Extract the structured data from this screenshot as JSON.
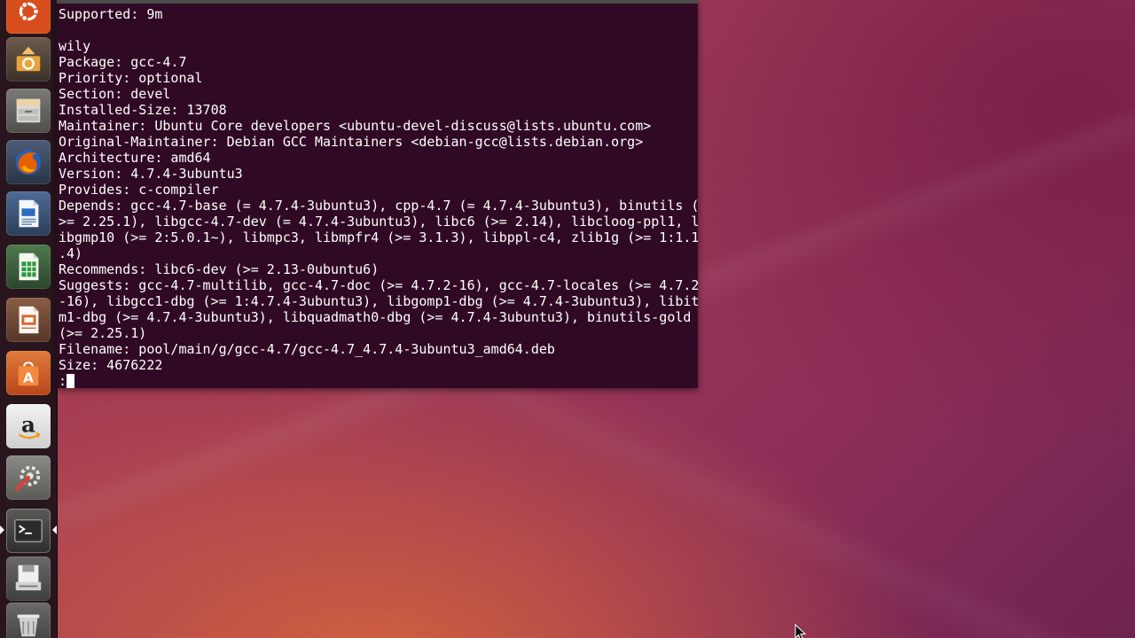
{
  "launcher": {
    "items": [
      {
        "name": "dash-home",
        "icon": "ubuntu-logo-icon",
        "color": "#dd4814"
      },
      {
        "name": "system-updater",
        "icon": "software-updater-icon",
        "color": "#e8a33c"
      },
      {
        "name": "files",
        "icon": "file-cabinet-icon",
        "color": "#8a8a86"
      },
      {
        "name": "firefox",
        "icon": "firefox-icon",
        "color": "#e66000"
      },
      {
        "name": "libreoffice-writer",
        "icon": "writer-document-icon",
        "color": "#2a6cc4"
      },
      {
        "name": "libreoffice-calc",
        "icon": "calc-spreadsheet-icon",
        "color": "#2e9a3e"
      },
      {
        "name": "libreoffice-impress",
        "icon": "impress-presentation-icon",
        "color": "#d9642b"
      },
      {
        "name": "ubuntu-software-center",
        "icon": "shopping-bag-icon",
        "color": "#e86a23"
      },
      {
        "name": "amazon",
        "icon": "amazon-icon",
        "color": "#f4f4f4"
      },
      {
        "name": "system-settings",
        "icon": "wrench-gear-icon",
        "color": "#c9c9c9"
      },
      {
        "name": "terminal",
        "icon": "terminal-icon",
        "color": "#2d2d2d",
        "active": true
      },
      {
        "name": "disk-drive",
        "icon": "floppy-drive-icon",
        "color": "#dcdcdc"
      },
      {
        "name": "trash",
        "icon": "trash-icon",
        "color": "#b9b9b9"
      }
    ]
  },
  "terminal": {
    "lines": [
      "Supported: 9m",
      "",
      "wily",
      "Package: gcc-4.7",
      "Priority: optional",
      "Section: devel",
      "Installed-Size: 13708",
      "Maintainer: Ubuntu Core developers <ubuntu-devel-discuss@lists.ubuntu.com>",
      "Original-Maintainer: Debian GCC Maintainers <debian-gcc@lists.debian.org>",
      "Architecture: amd64",
      "Version: 4.7.4-3ubuntu3",
      "Provides: c-compiler",
      "Depends: gcc-4.7-base (= 4.7.4-3ubuntu3), cpp-4.7 (= 4.7.4-3ubuntu3), binutils (",
      ">= 2.25.1), libgcc-4.7-dev (= 4.7.4-3ubuntu3), libc6 (>= 2.14), libcloog-ppl1, l",
      "ibgmp10 (>= 2:5.0.1~), libmpc3, libmpfr4 (>= 3.1.3), libppl-c4, zlib1g (>= 1:1.1",
      ".4)",
      "Recommends: libc6-dev (>= 2.13-0ubuntu6)",
      "Suggests: gcc-4.7-multilib, gcc-4.7-doc (>= 4.7.2-16), gcc-4.7-locales (>= 4.7.2",
      "-16), libgcc1-dbg (>= 1:4.7.4-3ubuntu3), libgomp1-dbg (>= 4.7.4-3ubuntu3), libit",
      "m1-dbg (>= 4.7.4-3ubuntu3), libquadmath0-dbg (>= 4.7.4-3ubuntu3), binutils-gold",
      "(>= 2.25.1)",
      "Filename: pool/main/g/gcc-4.7/gcc-4.7_4.7.4-3ubuntu3_amd64.deb",
      "Size: 4676222"
    ],
    "prompt": ":",
    "background": "#300a24",
    "foreground": "#ffffff"
  }
}
